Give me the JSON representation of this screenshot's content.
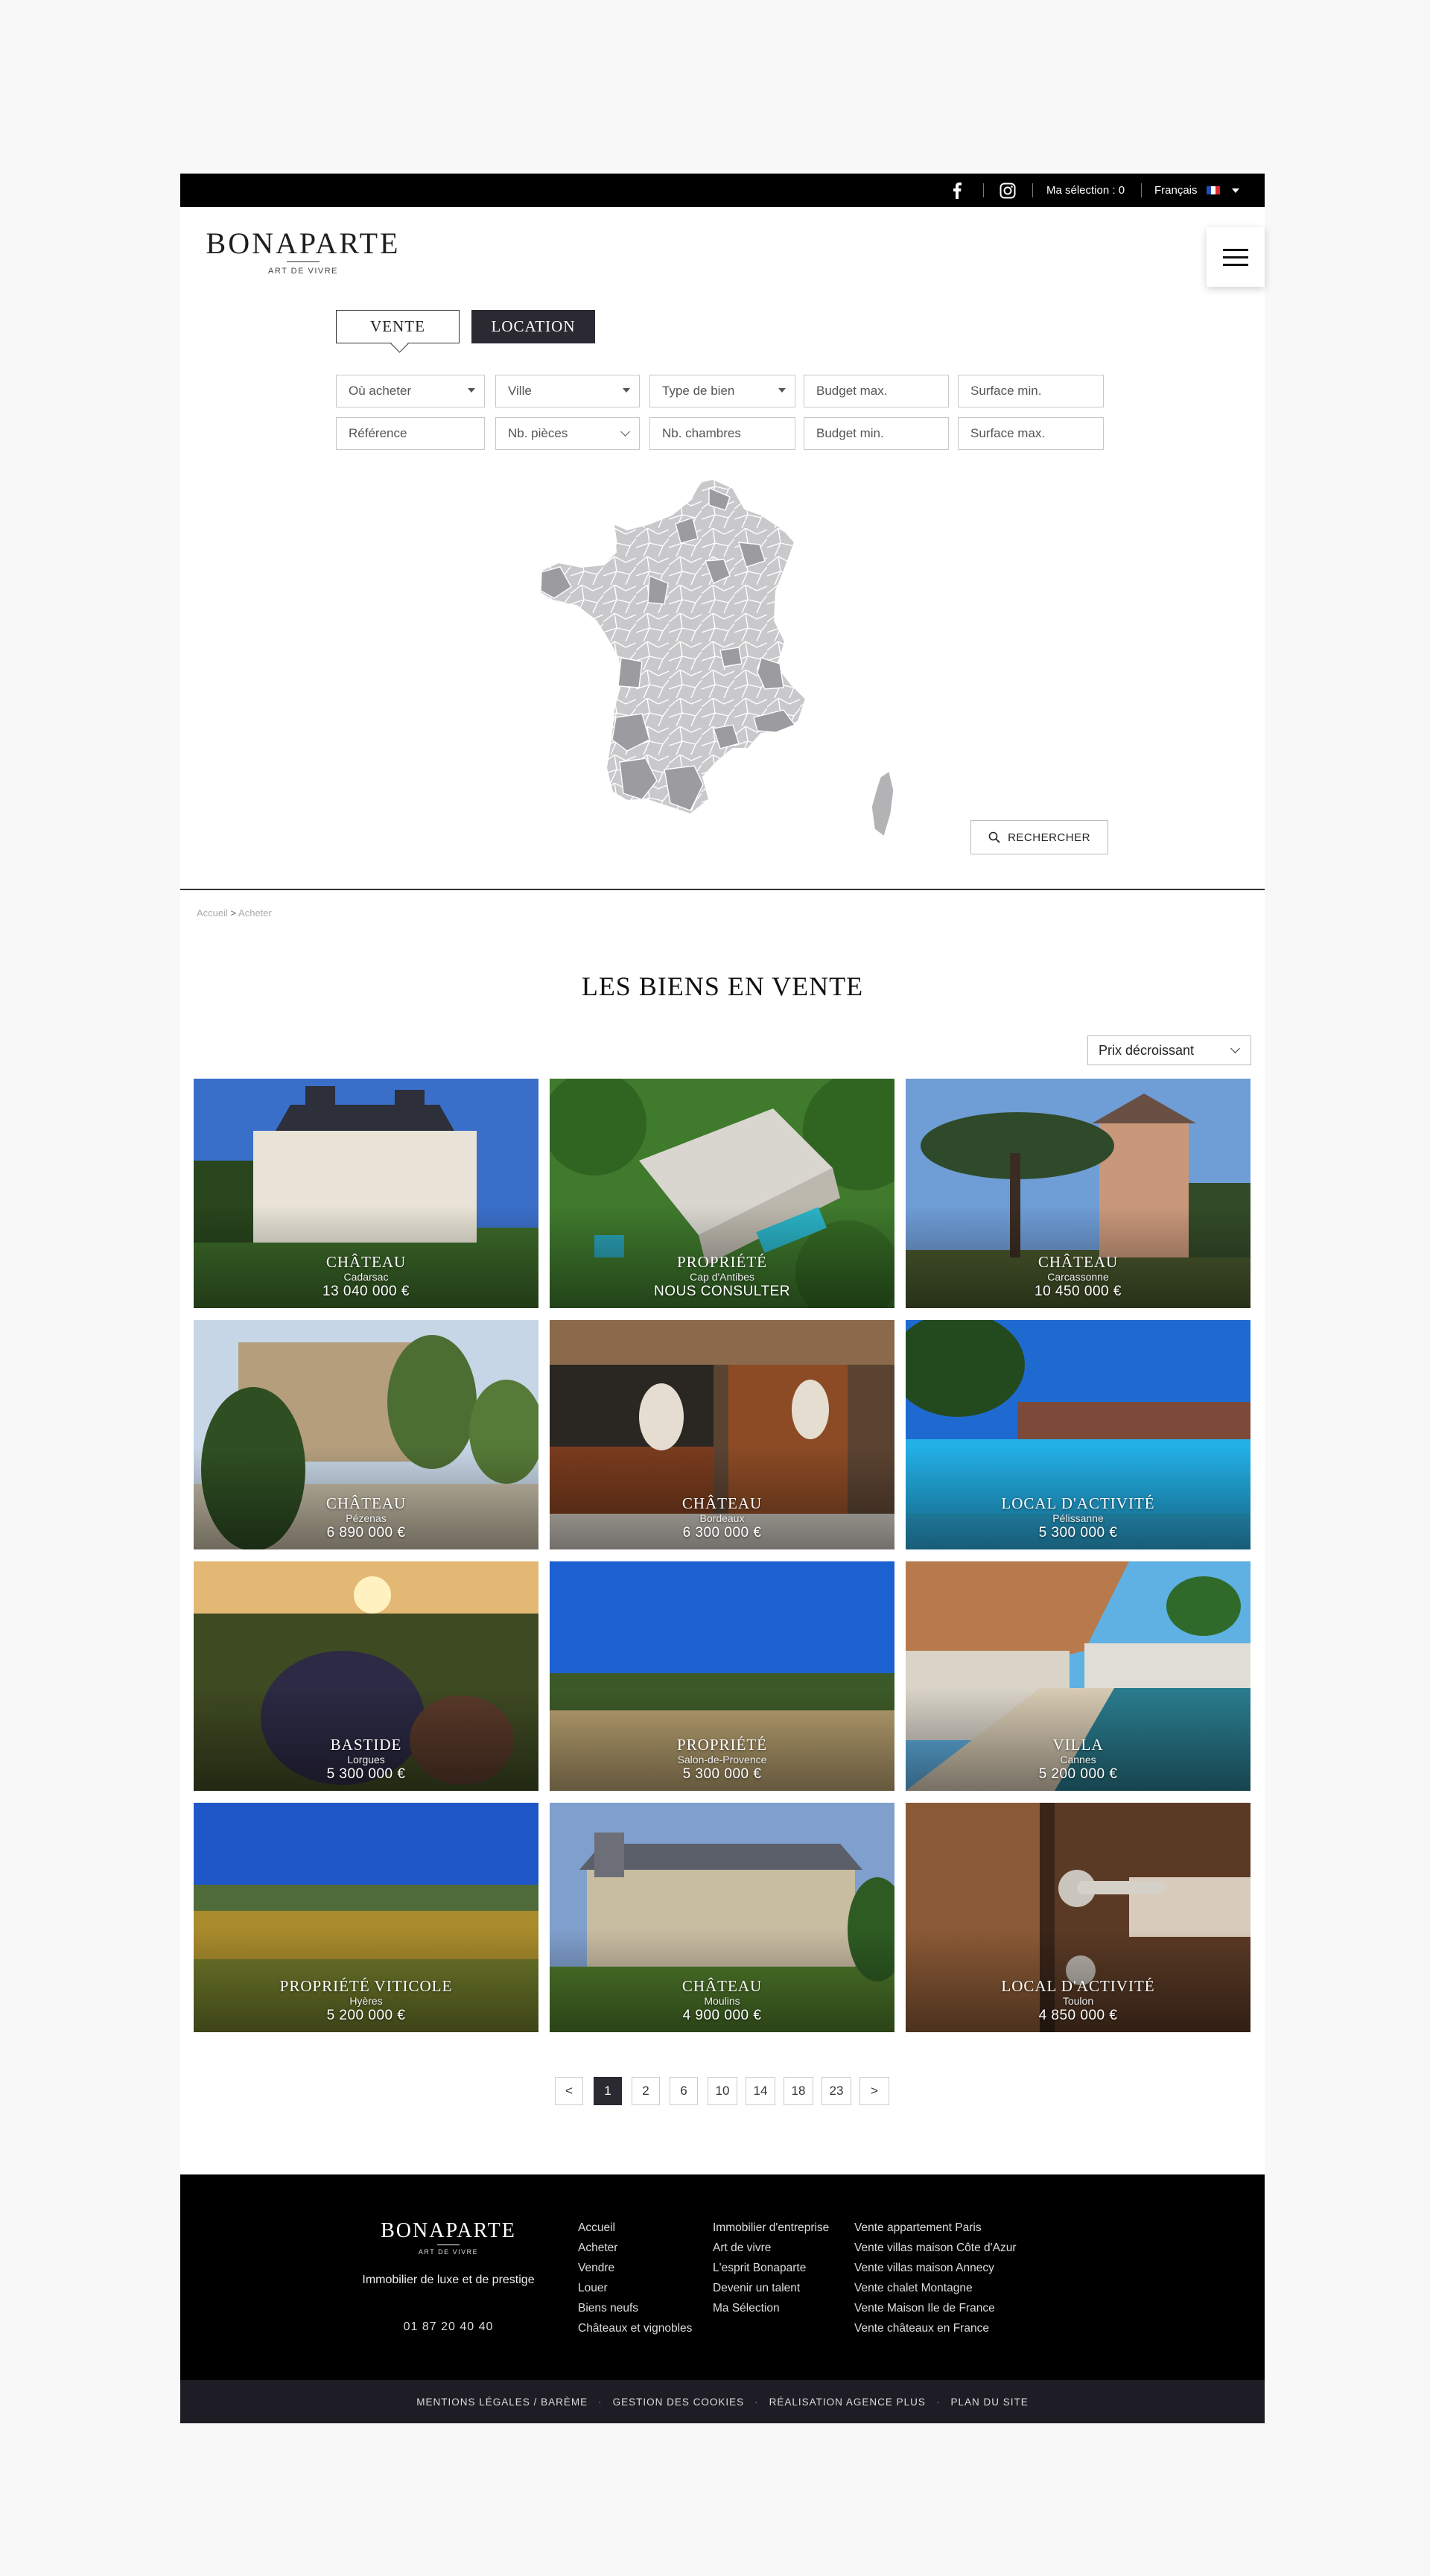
{
  "topbar": {
    "selection": "Ma sélection : 0",
    "language": "Français",
    "icons": [
      "facebook-icon",
      "instagram-icon",
      "flag-fr-icon",
      "caret-down-icon"
    ]
  },
  "brand": {
    "name": "BONAPARTE",
    "tagline": "ART DE VIVRE"
  },
  "tabs": {
    "vente": "VENTE",
    "location": "LOCATION"
  },
  "search": {
    "ou_acheter": "Où acheter",
    "ville": "Ville",
    "type_bien": "Type de bien",
    "budget_max": "Budget max.",
    "surface_min": "Surface min.",
    "reference": "Référence",
    "nb_pieces": "Nb. pièces",
    "nb_chambres": "Nb. chambres",
    "budget_min": "Budget min.",
    "surface_max": "Surface max.",
    "button": "RECHERCHER"
  },
  "breadcrumb": {
    "home": "Accueil",
    "separator": ">",
    "current": "Acheter"
  },
  "section_title": "LES BIENS EN VENTE",
  "sort": {
    "selected": "Prix décroissant"
  },
  "listings": [
    {
      "type": "CHÂTEAU",
      "city": "Cadarsac",
      "price": "13 040 000 €"
    },
    {
      "type": "PROPRIÉTÉ",
      "city": "Cap d'Antibes",
      "price": "NOUS CONSULTER"
    },
    {
      "type": "CHÂTEAU",
      "city": "Carcassonne",
      "price": "10 450 000 €"
    },
    {
      "type": "CHÂTEAU",
      "city": "Pézenas",
      "price": "6 890 000 €"
    },
    {
      "type": "CHÂTEAU",
      "city": "Bordeaux",
      "price": "6 300 000 €"
    },
    {
      "type": "LOCAL D'ACTIVITÉ",
      "city": "Pélissanne",
      "price": "5 300 000 €"
    },
    {
      "type": "BASTIDE",
      "city": "Lorgues",
      "price": "5 300 000 €"
    },
    {
      "type": "PROPRIÉTÉ",
      "city": "Salon-de-Provence",
      "price": "5 300 000 €"
    },
    {
      "type": "VILLA",
      "city": "Cannes",
      "price": "5 200 000 €"
    },
    {
      "type": "PROPRIÉTÉ VITICOLE",
      "city": "Hyères",
      "price": "5 200 000 €"
    },
    {
      "type": "CHÂTEAU",
      "city": "Moulins",
      "price": "4 900 000 €"
    },
    {
      "type": "LOCAL D'ACTIVITÉ",
      "city": "Toulon",
      "price": "4 850 000 €"
    }
  ],
  "pagination": [
    "<",
    "1",
    "2",
    "6",
    "10",
    "14",
    "18",
    "23",
    ">"
  ],
  "pagination_active": "1",
  "footer": {
    "tagline": "Immobilier de luxe et de prestige",
    "phone": "01 87 20 40 40",
    "col1": [
      "Accueil",
      "Acheter",
      "Vendre",
      "Louer",
      "Biens neufs",
      "Châteaux et vignobles"
    ],
    "col2": [
      "Immobilier d'entreprise",
      "Art de vivre",
      "L'esprit Bonaparte",
      "Devenir un talent",
      "Ma Sélection"
    ],
    "col3": [
      "Vente appartement Paris",
      "Vente villas maison Côte d'Azur",
      "Vente villas maison Annecy",
      "Vente chalet Montagne",
      "Vente Maison Ile de France",
      "Vente châteaux en France"
    ]
  },
  "bottom_links": [
    "MENTIONS LÉGALES / BARÈME",
    "GESTION DES COOKIES",
    "RÉALISATION AGENCE PLUS",
    "PLAN DU SITE"
  ]
}
